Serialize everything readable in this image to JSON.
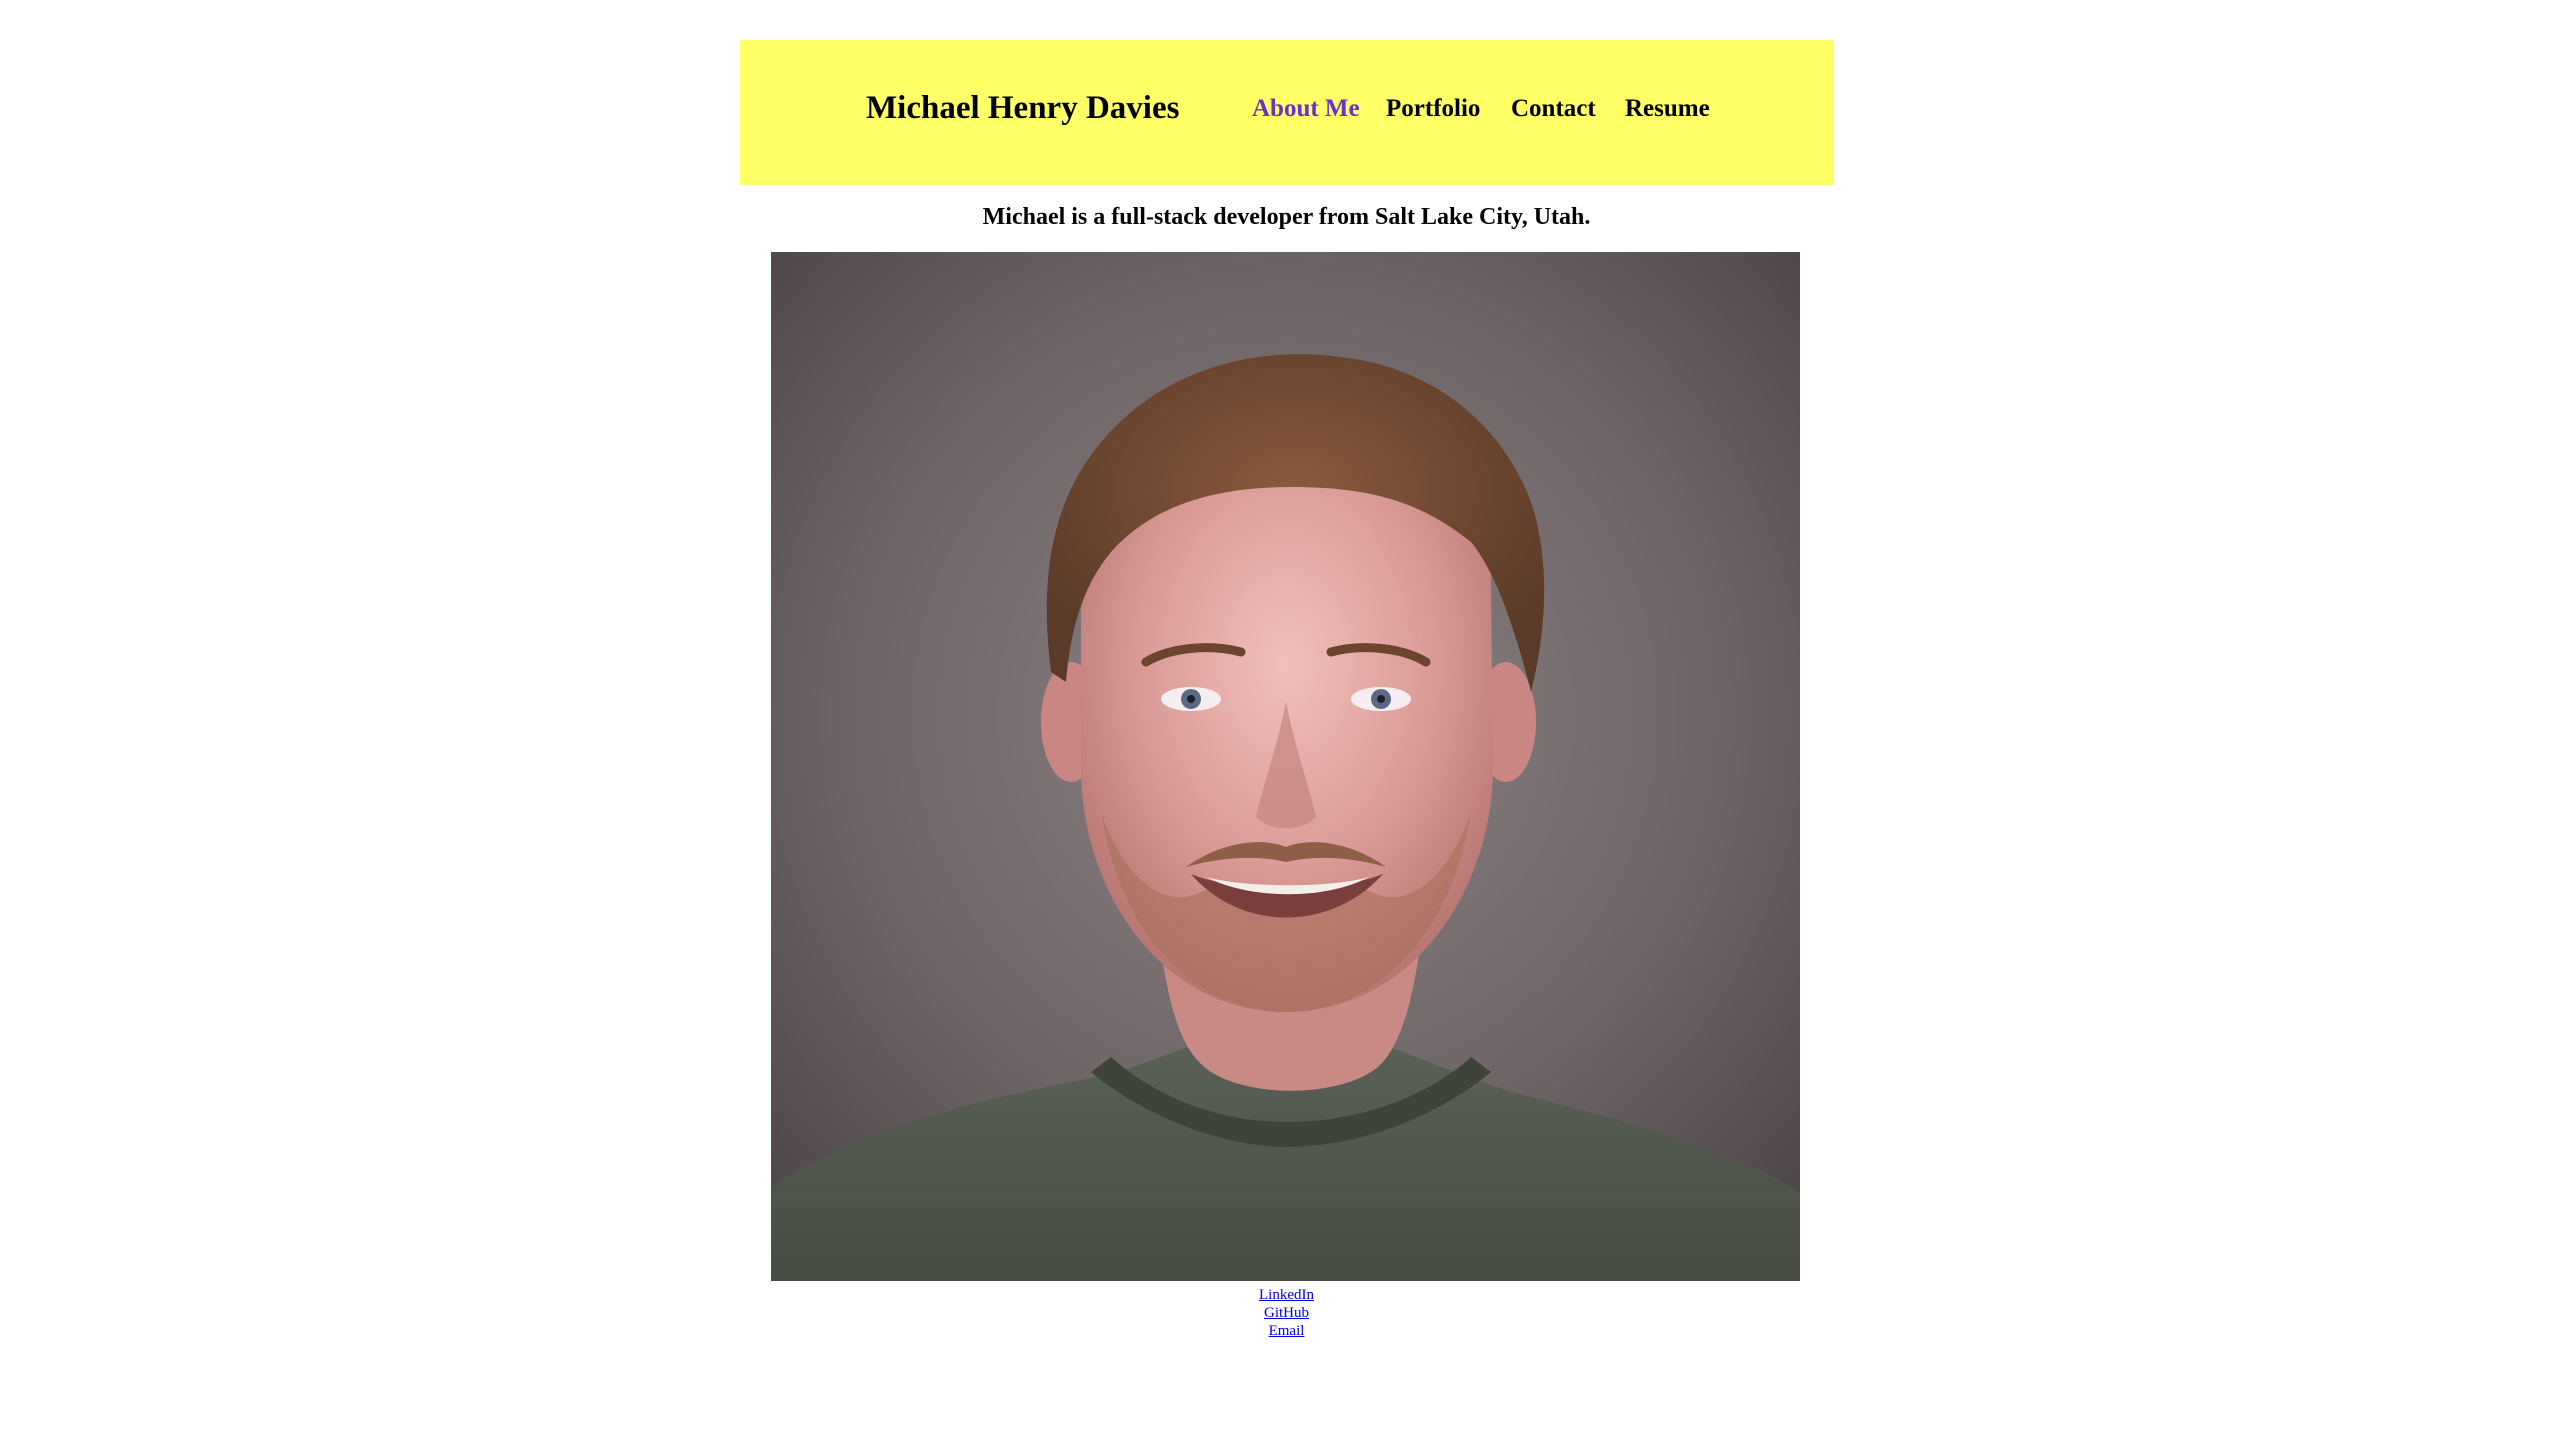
{
  "header": {
    "site_name": "Michael Henry Davies",
    "nav": [
      {
        "label": "About Me",
        "active": true
      },
      {
        "label": "Portfolio",
        "active": false
      },
      {
        "label": "Contact",
        "active": false
      },
      {
        "label": "Resume",
        "active": false
      }
    ],
    "background_color": "#ffff66",
    "active_color": "#6633cc"
  },
  "main": {
    "intro": "Michael is a full-stack developer from Salt Lake City, Utah."
  },
  "footer": {
    "links": [
      {
        "label": "LinkedIn"
      },
      {
        "label": "GitHub"
      },
      {
        "label": "Email"
      }
    ],
    "link_color": "#0000ee"
  }
}
